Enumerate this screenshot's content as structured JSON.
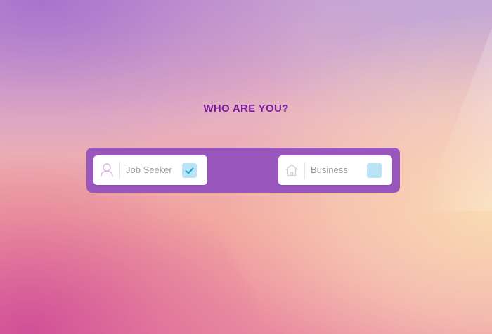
{
  "heading": "WHO ARE YOU?",
  "options": [
    {
      "label": "Job Seeker",
      "icon": "user-icon",
      "checked": true
    },
    {
      "label": "Business",
      "icon": "home-icon",
      "checked": false
    }
  ],
  "colors": {
    "heading": "#7a1ea0",
    "panel": "#9956bd",
    "checkbox": "#b9e3f6",
    "checkmark": "#1aa3d6"
  }
}
